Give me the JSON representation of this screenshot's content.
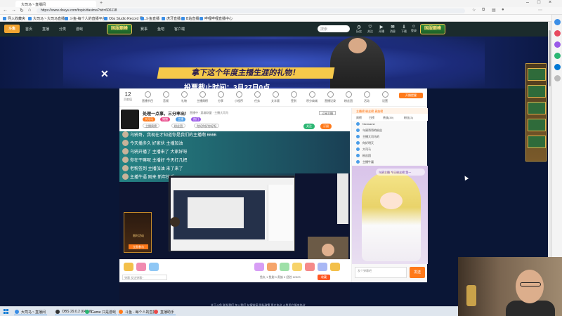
{
  "browser": {
    "tab_title": "大司马丶直播间",
    "url": "https://www.douyu.com/topic/dasima?rid=606118",
    "bookmarks": [
      "导入收藏夹",
      "大司马丶大司马直播...",
      "斗鱼-每个人的直播平台",
      "Obs Studio Record 导...",
      "斗鱼直播",
      "虎牙直播",
      "B站直播",
      "哔哩哔哩直播中心"
    ]
  },
  "site_nav": {
    "logo": "斗鱼",
    "items": [
      "首页",
      "直播",
      "分类",
      "游戏",
      "赛事",
      "鱼吧",
      "客户端"
    ],
    "brand": "国服巅峰",
    "brand2": "国服巅峰",
    "search_placeholder": "搜索",
    "right_icons": [
      "历史",
      "关注",
      "开播",
      "消息",
      "下载",
      "登录"
    ]
  },
  "banner": {
    "headline": "拿下这个年度主播生涯的礼物！",
    "subline": "投票截止时间：3月27日0点"
  },
  "toolbar": {
    "viewers": "12",
    "viewers_label": "贡献值",
    "items": [
      "直播节目",
      "音频",
      "礼物",
      "主播周榜",
      "分享",
      "小程序",
      "任务",
      "文字版",
      "签到",
      "积分商城",
      "直播记录",
      "粉丝团",
      "活动",
      "设置"
    ],
    "orange_btn": "开播提醒"
  },
  "stream": {
    "title": "处理一点事，三分率出！",
    "meta": "直播中 · 英雄联盟 · 主播大司马",
    "sub_label": "订阅主播",
    "tags": [
      "大司马",
      "猪猪",
      "主播",
      "热门"
    ],
    "row_tags": [
      "主播周榜",
      "粉丝团",
      "你好你好你好呀"
    ],
    "follow_btn": "关注",
    "sub_btn": "订阅"
  },
  "danmaku": [
    "乌鸦哥，我现在才知道你是我们的主播啊 6666",
    "今天播多久  好家伙  主播加油",
    "乌鸦开播了  主播来了  大家好呀",
    "你在干嘛呢  主播好  今天打几把",
    "老粉签到  主播加油  来了来了",
    "主播牛逼  刚来  新年快乐"
  ],
  "promo": {
    "text": "限时活动",
    "button": "立即参与"
  },
  "giftbar": {
    "input_placeholder": "弹幕 发送弹幕~",
    "stats": "鱼丸 1 鱼翅 0 贵族 0 经验 12323",
    "fav_btn": "收藏"
  },
  "right_panel": {
    "tabs": "主播榜  粉丝榜  贵族榜",
    "subtabs": [
      "周榜",
      "日榜",
      "贵族(39)",
      "粉丝(3)"
    ],
    "fans": [
      "Nickname",
      "乌鸦哥哥的粉丝",
      "主播大司马的",
      "你好明天",
      "大司马",
      "粉丝团",
      "主播牛逼"
    ],
    "chat_badge": "乌鸦主播  今日粉丝榜  第一",
    "send_placeholder": "发个弹幕吧",
    "send_btn": "发送"
  },
  "footer": {
    "links": "关于斗鱼  联系我们  加入我们  友情链接  隐私政策  用户协议  斗鱼用户服务协议"
  },
  "taskbar": {
    "tasks": [
      "大司马丶直播间",
      "OBS 29.0.2 (64-bit)",
      "Game 只是游戏",
      "斗鱼 - 每个人的直播",
      "直播助手"
    ]
  },
  "colors": {
    "page_bg": "#0a1636",
    "nav_bg": "#1b2b2c",
    "accent_orange": "#ff7a1a",
    "danmaku_teal": "#2da8a0",
    "banner_gold": "#f6c94a"
  }
}
